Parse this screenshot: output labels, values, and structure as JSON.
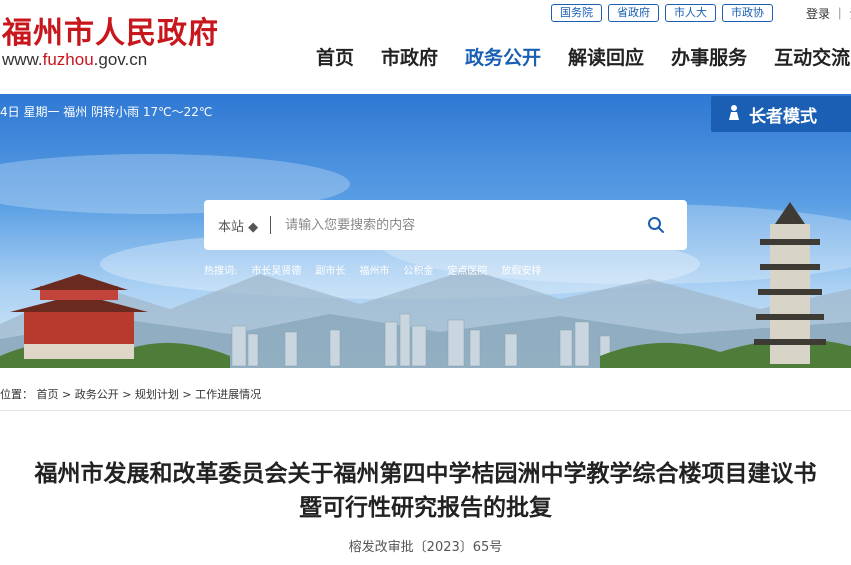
{
  "header": {
    "logo_cn": "福州市人民政府",
    "logo_url_prefix": "www.",
    "logo_url_brand": "fuzhou",
    "logo_url_suffix": ".gov.cn",
    "top_links": [
      "国务院",
      "省政府",
      "市人大",
      "市政协"
    ],
    "login_text": "登录 ｜ 注"
  },
  "nav": {
    "items": [
      "首页",
      "市政府",
      "政务公开",
      "解读回应",
      "办事服务",
      "互动交流"
    ],
    "active": "政务公开"
  },
  "banner": {
    "weather": "4日 星期一  福州 阴转小雨 17℃～22℃",
    "elder_mode": "长者模式",
    "search_scope": "本站 ◆",
    "search_placeholder": "请输入您要搜索的内容",
    "hot_label": "热搜词:",
    "hot_words": [
      "市长吴贤德",
      "副市长",
      "福州市",
      "公积金",
      "定点医院",
      "放假安排"
    ]
  },
  "breadcrumb": "位置：  首页 > 政务公开 > 规划计划 > 工作进展情况",
  "article": {
    "title_line1": "福州市发展和改革委员会关于福州第四中学桔园洲中学教学综合楼项目建议书",
    "title_line2": "暨可行性研究报告的批复",
    "doc_number": "榕发改审批〔2023〕65号"
  },
  "colors": {
    "brand_red": "#c8161d",
    "accent_blue": "#1a5fb4"
  }
}
